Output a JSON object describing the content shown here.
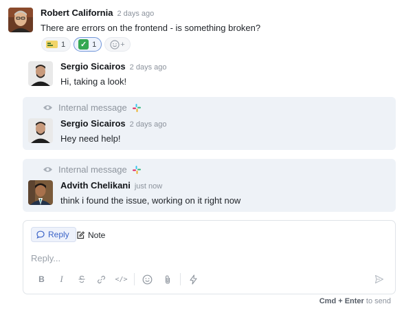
{
  "thread": {
    "root": {
      "author": "Robert California",
      "time": "2 days ago",
      "body": "There are errors on the frontend - is something broken?",
      "reactions": [
        {
          "emoji": "cash-icon",
          "count": "1",
          "active": false
        },
        {
          "emoji": "check-mark-icon",
          "count": "1",
          "active": true
        }
      ],
      "add_reaction_label": "+"
    },
    "replies": [
      {
        "author": "Sergio Sicairos",
        "time": "2 days ago",
        "body": "Hi, taking a look!",
        "internal": false
      },
      {
        "internal_label": "Internal message",
        "author": "Sergio Sicairos",
        "time": "2 days ago",
        "body": "Hey need help!",
        "internal": true
      },
      {
        "internal_label": "Internal message",
        "author": "Advith Chelikani",
        "time": "just now",
        "body": "think i found the issue, working on it right now",
        "internal": true
      }
    ]
  },
  "composer": {
    "tabs": {
      "reply": "Reply",
      "note": "Note"
    },
    "placeholder": "Reply...",
    "toolbar": {
      "bold": "B",
      "italic": "I",
      "code": "</>"
    }
  },
  "footer_hint": {
    "shortcut": "Cmd + Enter",
    "action": "to send"
  },
  "colors": {
    "accent": "#3a63c7",
    "internal_bg": "#eef2f7",
    "slack_red": "#e01e5a",
    "slack_green": "#2eb67d",
    "slack_blue": "#36c5f0",
    "slack_yellow": "#ecb22e"
  }
}
